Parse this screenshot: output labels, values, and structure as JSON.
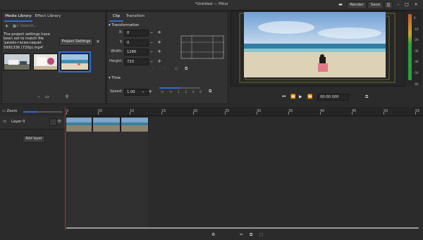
{
  "window": {
    "title": "*Untitled — Pitivi",
    "render_label": "Render",
    "save_label": "Save"
  },
  "media_library": {
    "tabs": [
      "Media Library",
      "Effect Library"
    ],
    "search_placeholder": "Search...",
    "message": "The project settings have been set to match file 'pexels-гасеа-raquel-5991336 (720p).mp4'",
    "project_settings_label": "Project Settings",
    "close_glyph": "×"
  },
  "clip_props": {
    "tabs": [
      "Clip",
      "Transition"
    ],
    "transformation_label": "Transformation",
    "x_label": "X:",
    "x_value": "0",
    "y_label": "Y:",
    "y_value": "0",
    "width_label": "Width:",
    "width_value": "1280",
    "height_label": "Height:",
    "height_value": "720",
    "time_label": "Time",
    "speed_label": "Speed:",
    "speed_value": "1.00",
    "speed_marks": [
      "¼",
      "½",
      "1",
      "2",
      "4",
      "8"
    ]
  },
  "viewer": {
    "timecode": "00:00.000"
  },
  "timeline": {
    "zoom_label": "Zoom",
    "layer_label": "Layer 0",
    "add_layer_label": "Add layer",
    "ruler_ticks": [
      "0",
      "05",
      "10",
      "15",
      "20",
      "25",
      "30",
      "35",
      "40",
      "45",
      "50",
      "55"
    ]
  },
  "audio_meter": {
    "scale": [
      "0",
      "-10",
      "-20",
      "-30",
      "-40",
      "-50",
      "-60"
    ]
  },
  "colors": {
    "accent": "#2e6bd6",
    "playhead": "#c62828",
    "meter_green": "#2e9e3a",
    "meter_yellow": "#c8a92c"
  }
}
